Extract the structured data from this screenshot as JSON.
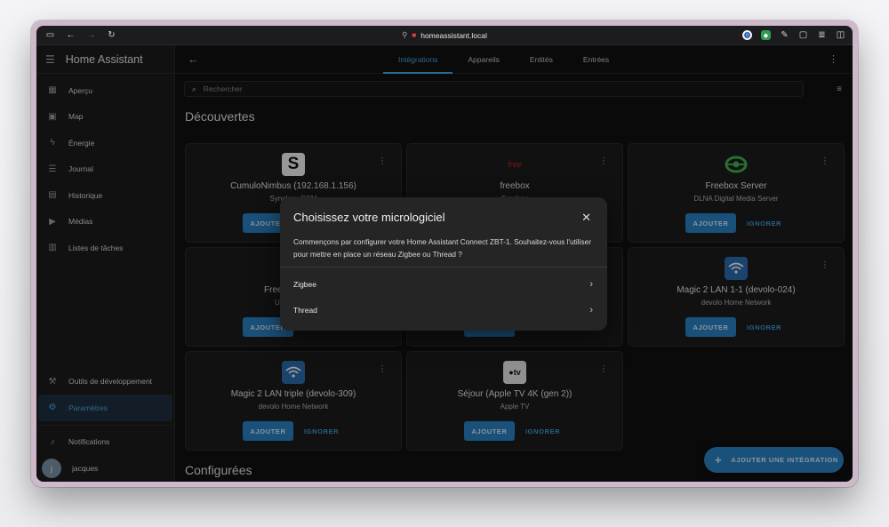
{
  "browser": {
    "url": "homeassistant.local"
  },
  "sidebar": {
    "title": "Home Assistant",
    "items": [
      {
        "label": "Aperçu",
        "icon": "grid-icon"
      },
      {
        "label": "Map",
        "icon": "map-icon"
      },
      {
        "label": "Énergie",
        "icon": "lightning-icon"
      },
      {
        "label": "Journal",
        "icon": "list-icon"
      },
      {
        "label": "Historique",
        "icon": "chart-icon"
      },
      {
        "label": "Médias",
        "icon": "play-icon"
      },
      {
        "label": "Listes de tâches",
        "icon": "clipboard-icon"
      }
    ],
    "dev_tools": "Outils de développement",
    "settings": "Paramètres",
    "notifications": "Notifications",
    "user": "jacques",
    "user_initial": "j"
  },
  "header": {
    "tabs": [
      "Intégrations",
      "Appareils",
      "Entités",
      "Entrées"
    ]
  },
  "search": {
    "placeholder": "Rechercher"
  },
  "sections": {
    "discovered": "Découvertes",
    "configured": "Configurées"
  },
  "cards": [
    {
      "name": "CumuloNimbus (192.168.1.156)",
      "sub": "Synology DSM",
      "logo": "S",
      "logo_icon": "synology-icon"
    },
    {
      "name": "freebox",
      "sub": "Freebox",
      "logo": "free",
      "logo_icon": "free-logo-icon"
    },
    {
      "name": "Freebox Server",
      "sub": "DLNA Digital Media Server",
      "logo": "",
      "logo_icon": "dlna-icon"
    },
    {
      "name": "Free",
      "sub": "U",
      "logo": "",
      "logo_icon": ""
    },
    {
      "name": "",
      "sub": "",
      "logo": "",
      "logo_icon": ""
    },
    {
      "name": "Magic 2 LAN 1-1 (devolo-024)",
      "sub": "devolo Home Network",
      "logo": "",
      "logo_icon": "devolo-wifi-icon"
    },
    {
      "name": "Magic 2 LAN triple (devolo-309)",
      "sub": "devolo Home Network",
      "logo": "",
      "logo_icon": "devolo-wifi-icon"
    },
    {
      "name": "Séjour (Apple TV 4K (gen 2))",
      "sub": "Apple TV",
      "logo": "tv",
      "logo_icon": "apple-tv-icon"
    }
  ],
  "buttons": {
    "add": "AJOUTER",
    "add_partial": "AJOUTER",
    "ignore": "IGNORER",
    "add_integration": "AJOUTER UNE INTÉGRATION"
  },
  "dialog": {
    "title": "Choisissez votre micrologiciel",
    "body": "Commençons par configurer votre Home Assistant Connect ZBT-1. Souhaitez-vous l'utiliser pour mettre en place un réseau Zigbee ou Thread ?",
    "options": [
      "Zigbee",
      "Thread"
    ]
  },
  "colors": {
    "accent": "#2a83c7",
    "accent_text": "#4aa8e8",
    "background": "#111111"
  }
}
